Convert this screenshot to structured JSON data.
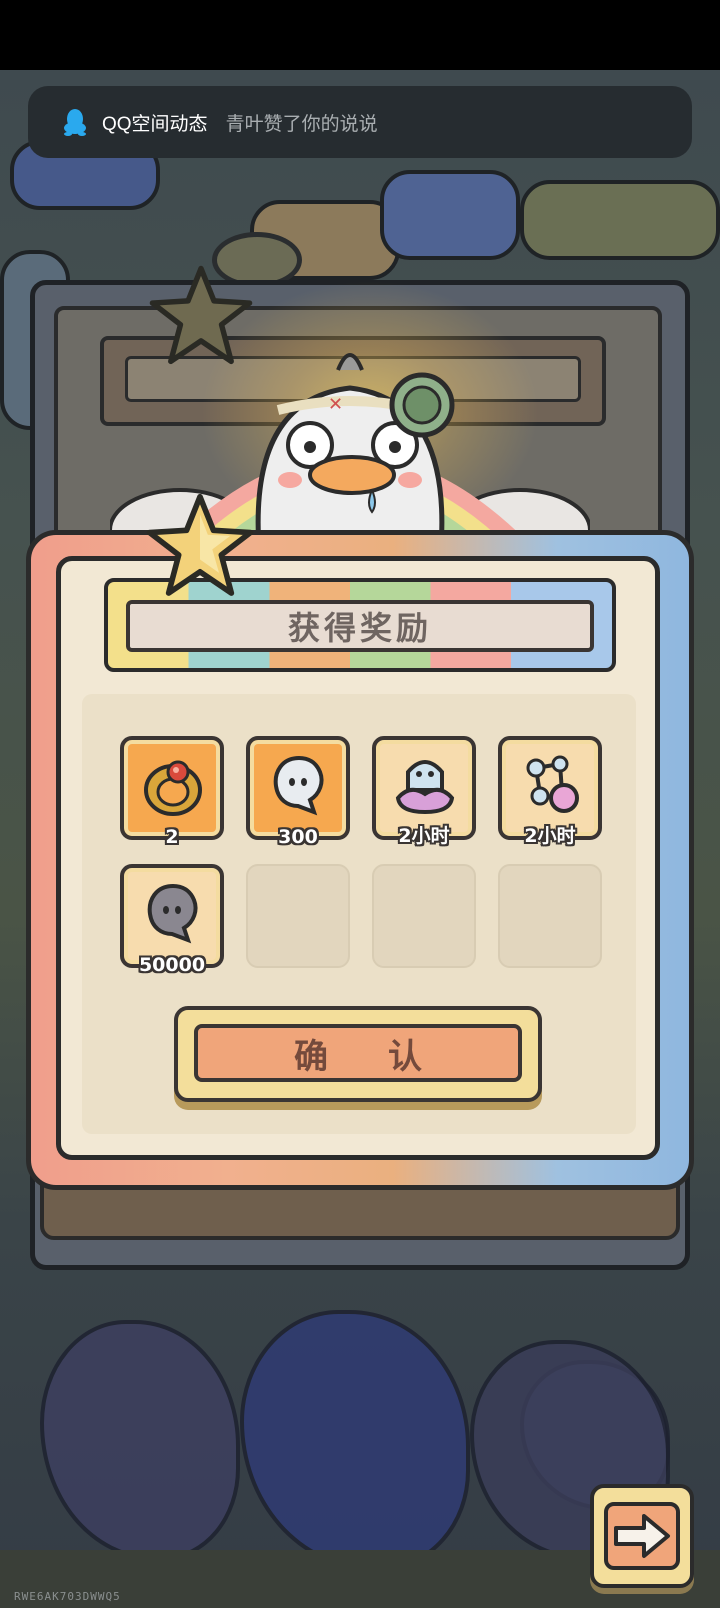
{
  "notification": {
    "app_name": "QQ空间动态",
    "message": "青叶赞了你的说说",
    "icon": "qq-penguin-icon"
  },
  "reward_panel": {
    "title": "获得奖励",
    "items": [
      {
        "icon": "ring-icon",
        "count": "2"
      },
      {
        "icon": "white-ghost-bubble-icon",
        "count": "300"
      },
      {
        "icon": "ghost-potion-icon",
        "count": "2小时"
      },
      {
        "icon": "molecule-potion-icon",
        "count": "2小时"
      },
      {
        "icon": "gray-ghost-bubble-icon",
        "count": "50000"
      }
    ],
    "empty_slots": 3,
    "confirm_label": "确认"
  },
  "next_button": {
    "icon": "right-arrow-icon"
  },
  "background_code": "RWE6AK703DWWQ5",
  "colors": {
    "slot_orange": "#f6a84f",
    "panel_cream": "#f2e8d4",
    "confirm_orange": "#f0a57a",
    "notification_bg": "#262c30"
  }
}
